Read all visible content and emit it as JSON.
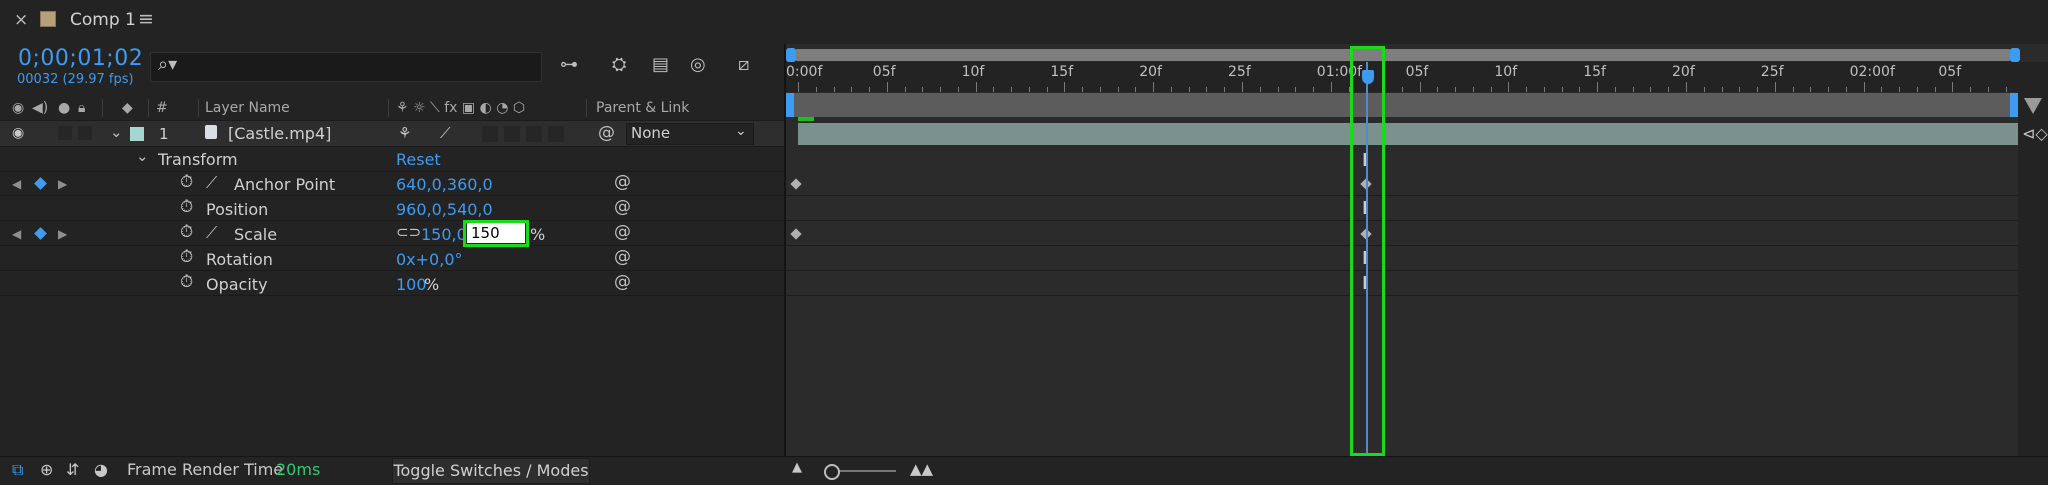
{
  "tab": {
    "title": "Comp 1",
    "close": "×",
    "menu": "≡"
  },
  "header": {
    "timecode": "0;00;01;02",
    "fps": "00032 (29.97 fps)",
    "search_placeholder": ""
  },
  "columns": {
    "number": "#",
    "layer_name": "Layer Name",
    "parent_link": "Parent & Link"
  },
  "layer": {
    "number": "1",
    "name": "[Castle.mp4]",
    "parent": "None"
  },
  "transform": {
    "label": "Transform",
    "reset": "Reset"
  },
  "properties": {
    "anchor": {
      "label": "Anchor Point",
      "value": "640,0,360,0"
    },
    "position": {
      "label": "Position",
      "value": "960,0,540,0"
    },
    "scale": {
      "label": "Scale",
      "value_x": "150,0,",
      "value_y": "150",
      "unit": "%"
    },
    "rotation": {
      "label": "Rotation",
      "value": "0x+0,0°"
    },
    "opacity": {
      "label": "Opacity",
      "value": "100",
      "unit": "%"
    }
  },
  "ruler": {
    "labels": [
      "0:00f",
      "05f",
      "10f",
      "15f",
      "20f",
      "25f",
      "01:00f",
      "05f",
      "10f",
      "15f",
      "20f",
      "25f",
      "02:00f",
      "05f"
    ]
  },
  "footer": {
    "render_label": "Frame Render Time",
    "render_value": "20ms",
    "toggle": "Toggle Switches / Modes"
  },
  "colors": {
    "accent": "#3d9bf0",
    "highlight": "#19dc19",
    "layer_bar": "#7a918d",
    "render_value": "#2ecc71"
  },
  "icons": [
    "close-icon",
    "comp-swatch-icon",
    "menu-icon",
    "search-icon",
    "eye-icon",
    "audio-icon",
    "solo-icon",
    "lock-icon",
    "label-tag-icon",
    "stopwatch-icon",
    "graph-icon",
    "spiral-icon",
    "link-icon",
    "chevron-down-icon",
    "ibeam-icon",
    "keyframe-icon",
    "playhead-icon"
  ]
}
